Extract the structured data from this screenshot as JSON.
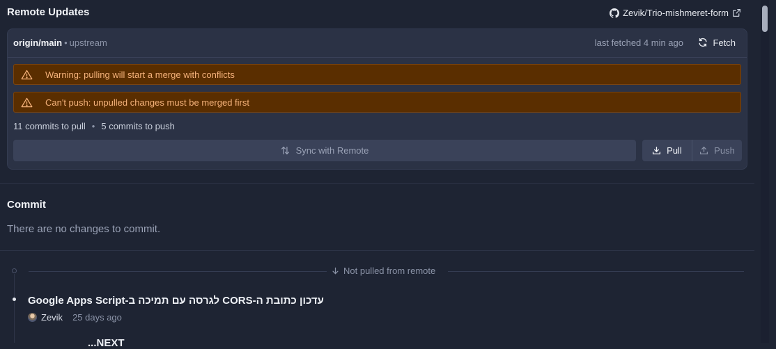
{
  "header": {
    "title": "Remote Updates",
    "repo": "Zevik/Trio-mishmeret-form"
  },
  "remote": {
    "branch": "origin/main",
    "upstream_label": "upstream",
    "last_fetched": "last fetched 4 min ago",
    "fetch_label": "Fetch",
    "warnings": [
      "Warning: pulling will start a merge with conflicts",
      "Can't push: unpulled changes must be merged first"
    ],
    "commits_to_pull": "11 commits to pull",
    "commits_to_push": "5 commits to push",
    "sync_label": "Sync with Remote",
    "pull_label": "Pull",
    "push_label": "Push"
  },
  "commit": {
    "title": "Commit",
    "empty_message": "There are no changes to commit."
  },
  "timeline": {
    "section_label": "Not pulled from remote",
    "commits": [
      {
        "message": "עדכון כתובת ה-CORS לגרסה עם תמיכה ב-Google Apps Script",
        "author": "Zevik",
        "time": "25 days ago"
      }
    ],
    "partial_next": "...NEXT"
  },
  "colors": {
    "background": "#1e2433",
    "panel": "#2b3245",
    "warning_bg": "#5a2e00",
    "warning_text": "#f5b27a",
    "button": "#3a4259"
  }
}
